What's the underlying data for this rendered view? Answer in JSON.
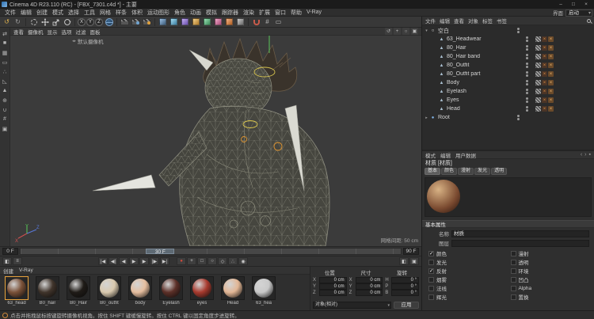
{
  "window": {
    "title": "Cinema 4D R23.110 (RC) - [FBX_7301.c4d *] - 主要",
    "minimize": "–",
    "maximize": "□",
    "close": "×"
  },
  "menubar": {
    "items": [
      "文件",
      "编辑",
      "创建",
      "模式",
      "选择",
      "工具",
      "网格",
      "样条",
      "体积",
      "运动图形",
      "角色",
      "动画",
      "模拟",
      "跟踪器",
      "渲染",
      "扩展",
      "窗口",
      "帮助",
      "V-Ray"
    ],
    "right_label": "界面",
    "right_value": "启动"
  },
  "toolbar": {
    "axis_locks": [
      "X",
      "Y",
      "Z"
    ],
    "tool_names": [
      "undo",
      "redo",
      "live-selection",
      "move",
      "scale",
      "rotate",
      "lock-x",
      "lock-y",
      "lock-z",
      "coordinate-system",
      "render-view",
      "render-picture-viewer",
      "render-settings",
      "add-cube",
      "add-spline",
      "add-generator",
      "add-deformer",
      "add-mograph",
      "add-character",
      "add-volume",
      "add-simulation",
      "snap",
      "grid-snap",
      "workplane"
    ]
  },
  "left_toolbar": {
    "tool_names": [
      "make-editable",
      "model-mode",
      "texture-mode",
      "workplane-mode",
      "points-mode",
      "edges-mode",
      "polygons-mode",
      "enable-axis",
      "snap-toggle",
      "grid-toggle",
      "viewport-filter"
    ],
    "glyphs": [
      "⇄",
      "■",
      "▦",
      "▭",
      "∴",
      "◺",
      "▲",
      "⊕",
      "∪",
      "#",
      "▣"
    ]
  },
  "viewport": {
    "menu": [
      "查看",
      "摄像机",
      "显示",
      "选项",
      "过滤",
      "面板"
    ],
    "camera_label": "默认摄像机",
    "camera_arrows": "◂▸",
    "grid_hint": "网格间距: 50 cm",
    "axes": {
      "x": "X",
      "y": "Y",
      "z": "Z"
    },
    "icon_names": [
      "orbit-icon",
      "pan-icon",
      "zoom-icon",
      "maximize-icon"
    ],
    "icon_glyphs": [
      "↺",
      "+",
      "○",
      "▣"
    ]
  },
  "object_manager": {
    "menu": [
      "文件",
      "编辑",
      "查看",
      "对象",
      "标签",
      "书签"
    ],
    "objects": [
      {
        "name": "空白",
        "pad": "2px",
        "expander": "▾",
        "icon_glyph": "○",
        "icon_color": "#e8e8e8",
        "tags_display": "none"
      },
      {
        "name": "63_Headwear",
        "pad": "13px",
        "expander": "",
        "icon_glyph": "▲",
        "icon_color": "#a9bfd0",
        "tags_display": "flex"
      },
      {
        "name": "80_Hair",
        "pad": "13px",
        "expander": "",
        "icon_glyph": "▲",
        "icon_color": "#a9bfd0",
        "tags_display": "flex"
      },
      {
        "name": "80_Hair band",
        "pad": "13px",
        "expander": "",
        "icon_glyph": "▲",
        "icon_color": "#a9bfd0",
        "tags_display": "flex"
      },
      {
        "name": "80_Outfit",
        "pad": "13px",
        "expander": "",
        "icon_glyph": "▲",
        "icon_color": "#a9bfd0",
        "tags_display": "flex"
      },
      {
        "name": "80_Outfit part",
        "pad": "13px",
        "expander": "",
        "icon_glyph": "▲",
        "icon_color": "#a9bfd0",
        "tags_display": "flex"
      },
      {
        "name": "Body",
        "pad": "13px",
        "expander": "",
        "icon_glyph": "▲",
        "icon_color": "#a9bfd0",
        "tags_display": "flex"
      },
      {
        "name": "Eyelash",
        "pad": "13px",
        "expander": "",
        "icon_glyph": "▲",
        "icon_color": "#a9bfd0",
        "tags_display": "flex"
      },
      {
        "name": "Eyes",
        "pad": "13px",
        "expander": "",
        "icon_glyph": "▲",
        "icon_color": "#a9bfd0",
        "tags_display": "flex"
      },
      {
        "name": "Head",
        "pad": "13px",
        "expander": "",
        "icon_glyph": "▲",
        "icon_color": "#a9bfd0",
        "tags_display": "flex"
      },
      {
        "name": "Root",
        "pad": "2px",
        "expander": "▸",
        "icon_glyph": "●",
        "icon_color": "#7fb2e5",
        "tags_display": "none"
      }
    ]
  },
  "attribute_manager": {
    "tabs": [
      "模式",
      "编辑",
      "用户数据"
    ],
    "history_icons": [
      "‹",
      "›"
    ],
    "title": "材质 [材质]",
    "chips": [
      {
        "label": "基本",
        "active": true
      },
      {
        "label": "颜色"
      },
      {
        "label": "漫射"
      },
      {
        "label": "发光"
      },
      {
        "label": "透明"
      }
    ],
    "section": "基本属性",
    "fields": {
      "name_label": "名称",
      "name_value": "材质",
      "layer_label": "图层",
      "layer_value": ""
    },
    "channels": [
      {
        "label": "颜色",
        "checked": true
      },
      {
        "label": "漫射",
        "checked": false
      },
      {
        "label": "发光",
        "checked": false
      },
      {
        "label": "透明",
        "checked": false
      },
      {
        "label": "反射",
        "checked": true
      },
      {
        "label": "环境",
        "checked": false
      },
      {
        "label": "烟雾",
        "checked": false
      },
      {
        "label": "凹凸",
        "checked": false
      },
      {
        "label": "法线",
        "checked": false
      },
      {
        "label": "Alpha",
        "checked": false
      },
      {
        "label": "辉光",
        "checked": false
      },
      {
        "label": "置换",
        "checked": false
      }
    ]
  },
  "timeline": {
    "start": "0 F",
    "end": "90 F",
    "current": "30 F"
  },
  "transport": {
    "left_icon_names": [
      "timeline-mode-icon",
      "options-icon"
    ],
    "playback": [
      {
        "name": "go-to-start",
        "glyph": "|◀"
      },
      {
        "name": "previous-key",
        "glyph": "◀|"
      },
      {
        "name": "previous-frame",
        "glyph": "◀"
      },
      {
        "name": "play",
        "glyph": "▶"
      },
      {
        "name": "next-frame",
        "glyph": "▶"
      },
      {
        "name": "next-key",
        "glyph": "|▶"
      },
      {
        "name": "go-to-end",
        "glyph": "▶|"
      }
    ],
    "record": [
      {
        "name": "record-keyframe",
        "glyph": "●",
        "color": "#d24a3a"
      },
      {
        "name": "key-position",
        "glyph": "+",
        "color": "#cccccc"
      },
      {
        "name": "key-scale",
        "glyph": "□",
        "color": "#cccccc"
      },
      {
        "name": "key-rotation",
        "glyph": "○",
        "color": "#cccccc"
      },
      {
        "name": "key-parameter",
        "glyph": "◇",
        "color": "#cccccc"
      },
      {
        "name": "key-pla",
        "glyph": "∴",
        "color": "#cccccc"
      },
      {
        "name": "autokey",
        "glyph": "◉",
        "color": "#cccccc"
      }
    ],
    "right": [
      {
        "name": "solo-toggle",
        "glyph": "◧",
        "color": "#cccccc"
      },
      {
        "name": "render-toggle",
        "glyph": "▣",
        "color": "#cccccc"
      }
    ]
  },
  "materials": {
    "menu": [
      "创建",
      "V-Ray"
    ],
    "items": [
      {
        "name": "63_head",
        "color": "#7a5138",
        "selected": true
      },
      {
        "name": "B0_hair",
        "color": "#40342b"
      },
      {
        "name": "B0_Hair",
        "color": "#1f1b17"
      },
      {
        "name": "B0_outfit",
        "color": "#d9c9ae"
      },
      {
        "name": "body",
        "color": "#e5bd9e"
      },
      {
        "name": "Eyelash",
        "color": "#5c3028"
      },
      {
        "name": "eyes",
        "color": "#a83a2e"
      },
      {
        "name": "Head",
        "color": "#e2b695"
      },
      {
        "name": "63_hea",
        "color": "#c9c9c9"
      }
    ]
  },
  "coordinates": {
    "groups": [
      {
        "title": "位置",
        "rows": [
          {
            "label": "X",
            "value": "0 cm"
          },
          {
            "label": "Y",
            "value": "0 cm"
          },
          {
            "label": "Z",
            "value": "0 cm"
          }
        ]
      },
      {
        "title": "尺寸",
        "rows": [
          {
            "label": "X",
            "value": "0 cm"
          },
          {
            "label": "Y",
            "value": "0 cm"
          },
          {
            "label": "Z",
            "value": "0 cm"
          }
        ]
      },
      {
        "title": "旋转",
        "rows": [
          {
            "label": "H",
            "value": "0 °"
          },
          {
            "label": "P",
            "value": "0 °"
          },
          {
            "label": "B",
            "value": "0 °"
          }
        ]
      }
    ],
    "mode": "对象(相对)",
    "apply": "应用"
  },
  "statusbar": {
    "text": "点击并拖拽鼠标按键旋转摄像机视角。按住 SHIFT 键缓慢旋转。按住 CTRL 键以固定角度步进旋转。"
  },
  "colors": {
    "accent_blue": "#5f9fd6",
    "selection_yellow": "#d8c44e",
    "selection_orange": "#dd9330",
    "axis_x": "#d05050",
    "axis_y": "#58c858",
    "axis_z": "#5878d8"
  }
}
